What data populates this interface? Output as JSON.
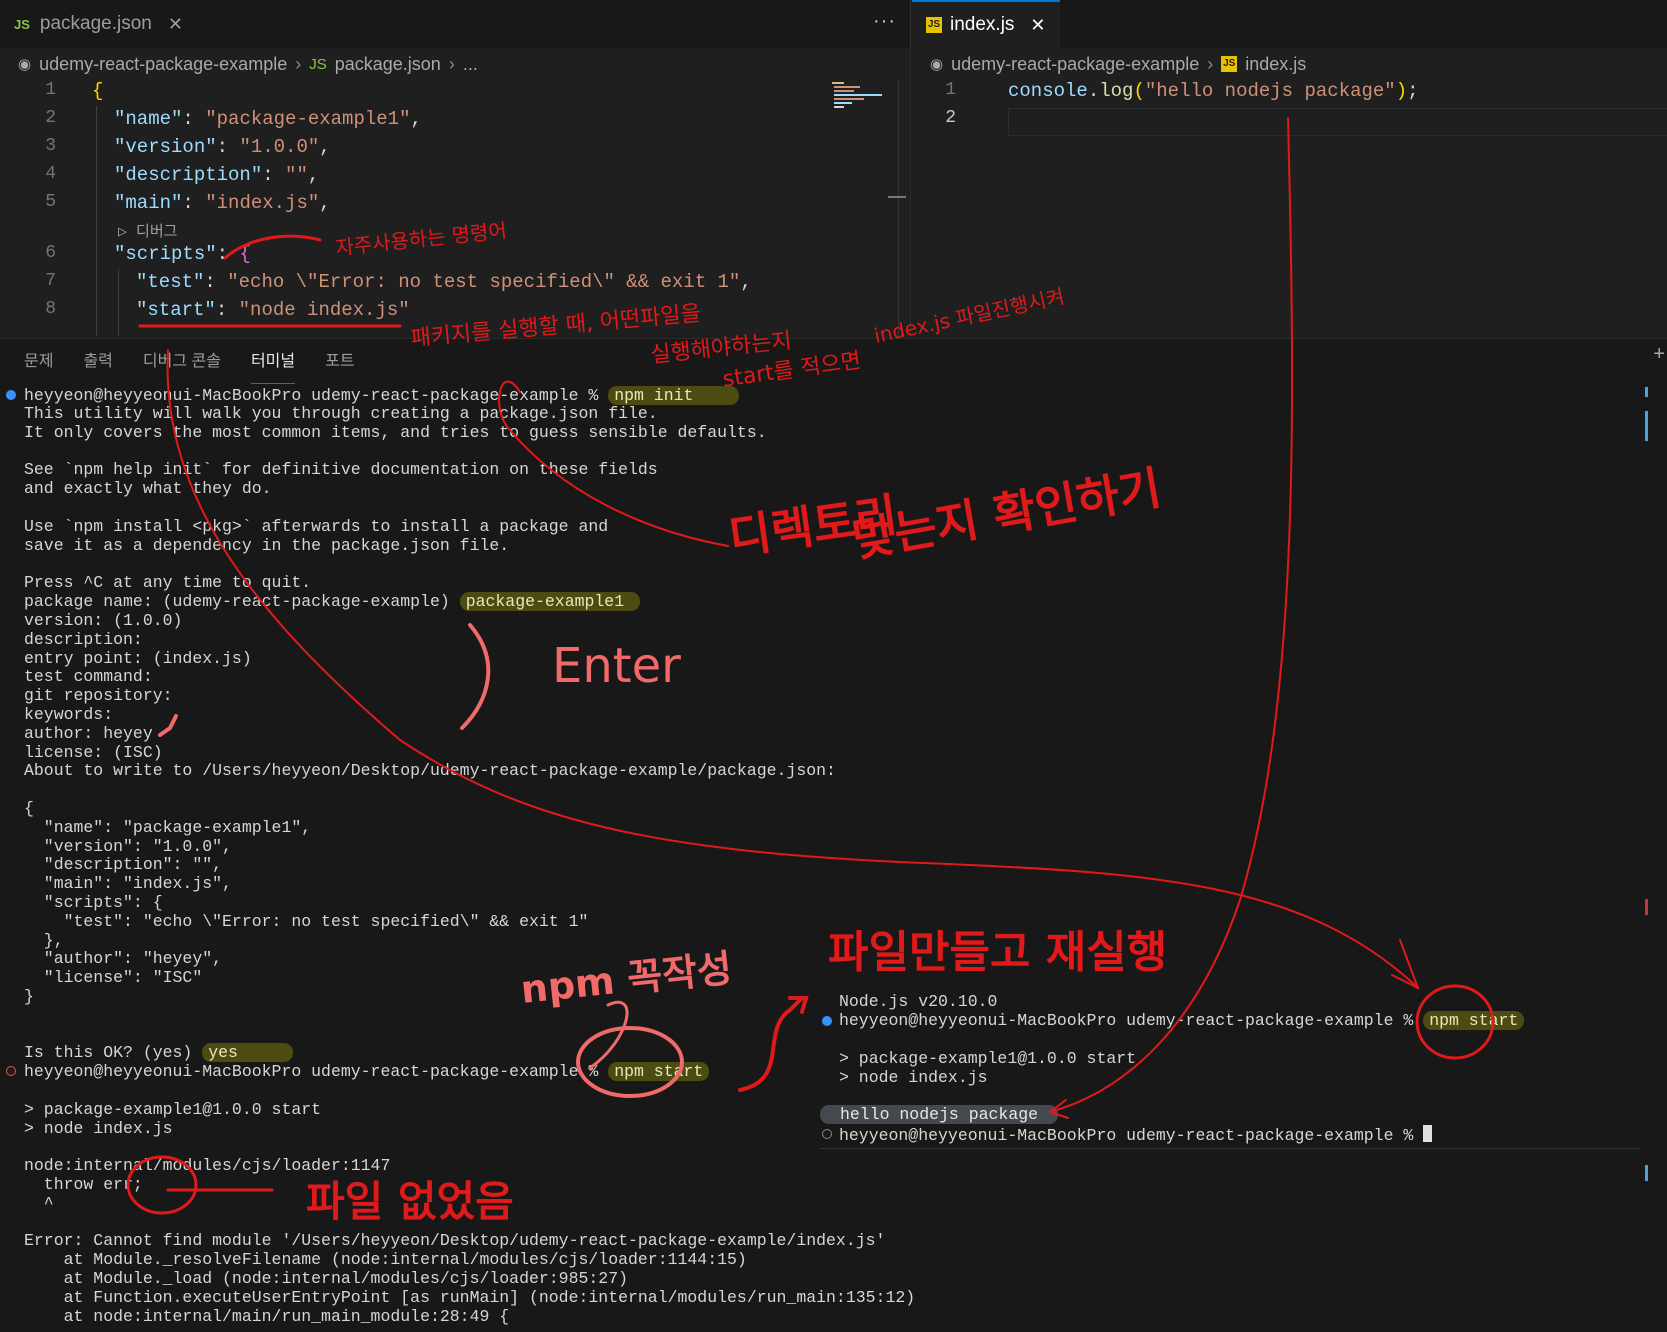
{
  "left_editor": {
    "tab_label": "package.json",
    "tab_icon": "JS",
    "more_label": "···",
    "breadcrumb": [
      "udemy-react-package-example",
      "package.json",
      "..."
    ],
    "line_numbers": [
      "1",
      "2",
      "3",
      "4",
      "5",
      "6",
      "7",
      "8"
    ],
    "codelens": "▷ 디버그",
    "code": {
      "l1": "{",
      "l2_key": "\"name\"",
      "l2_val": "\"package-example1\"",
      "l3_key": "\"version\"",
      "l3_val": "\"1.0.0\"",
      "l4_key": "\"description\"",
      "l4_val": "\"\"",
      "l5_key": "\"main\"",
      "l5_val": "\"index.js\"",
      "l6_key": "\"scripts\"",
      "l6_brace": "{",
      "l7_key": "\"test\"",
      "l7_val": "\"echo \\\"Error: no test specified\\\" && exit 1\"",
      "l8_key": "\"start\"",
      "l8_val": "\"node index.js\""
    }
  },
  "right_editor": {
    "tab_label": "index.js",
    "tab_icon": "JS",
    "breadcrumb": [
      "udemy-react-package-example",
      "index.js"
    ],
    "line_numbers": [
      "1",
      "2"
    ],
    "code": {
      "obj": "console",
      "fn": "log",
      "str": "\"hello nodejs package\""
    }
  },
  "panel": {
    "tabs": [
      "문제",
      "출력",
      "디버그 콘솔",
      "터미널",
      "포트"
    ],
    "active_tab": "터미널"
  },
  "terminal_left": {
    "prompt": "heyyeon@heyyeonui-MacBookPro udemy-react-package-example %",
    "cmd_init": "npm init",
    "intro": [
      "This utility will walk you through creating a package.json file.",
      "It only covers the most common items, and tries to guess sensible defaults.",
      "",
      "See `npm help init` for definitive documentation on these fields",
      "and exactly what they do.",
      "",
      "Use `npm install <pkg>` afterwards to install a package and",
      "save it as a dependency in the package.json file.",
      "",
      "Press ^C at any time to quit."
    ],
    "pkg_name_prompt": "package name: (udemy-react-package-example)",
    "pkg_name_answer": "package-example1",
    "questions": [
      "version: (1.0.0)",
      "description:",
      "entry point: (index.js)",
      "test command:",
      "git repository:",
      "keywords:",
      "author: heyey",
      "license: (ISC)",
      "About to write to /Users/heyyeon/Desktop/udemy-react-package-example/package.json:",
      "",
      "{",
      "  \"name\": \"package-example1\",",
      "  \"version\": \"1.0.0\",",
      "  \"description\": \"\",",
      "  \"main\": \"index.js\",",
      "  \"scripts\": {",
      "    \"test\": \"echo \\\"Error: no test specified\\\" && exit 1\"",
      "  },",
      "  \"author\": \"heyey\",",
      "  \"license\": \"ISC\"",
      "}"
    ],
    "ok_prompt": "Is this OK? (yes)",
    "ok_answer": "yes",
    "cmd_start": "npm start",
    "after": [
      "",
      "> package-example1@1.0.0 start",
      "> node index.js",
      "",
      "node:internal/modules/cjs/loader:1147",
      "  throw err;",
      "  ^",
      "",
      "Error: Cannot find module '/Users/heyyeon/Desktop/udemy-react-package-example/index.js'",
      "    at Module._resolveFilename (node:internal/modules/cjs/loader:1144:15)",
      "    at Module._load (node:internal/modules/cjs/loader:985:27)",
      "    at Function.executeUserEntryPoint [as runMain] (node:internal/modules/run_main:135:12)",
      "    at node:internal/main/run_main_module:28:49 {"
    ]
  },
  "terminal_right": {
    "node_version": "Node.js v20.10.0",
    "prompt": "heyyeon@heyyeonui-MacBookPro udemy-react-package-example %",
    "cmd": "npm start",
    "lines": [
      "",
      "> package-example1@1.0.0 start",
      "> node index.js",
      ""
    ],
    "output": "hello nodejs package"
  },
  "annotations": {
    "frequent_cmd": "자주사용하는 명령어",
    "start_desc_1": "패키지를 실행할 때, 어떤파일을",
    "start_desc_2": "실행해야하는지",
    "start_desc_3": "start를 적으면",
    "start_desc_4": "index.js 파일진행시켜",
    "check": "디렉토리",
    "check_2": "맞는지 확인하기",
    "enter": "Enter",
    "npm_must": "npm 꼭작성",
    "no_file": "파일 없었음",
    "remake": "파일만들고 재실행"
  },
  "colors": {
    "accent": "#0078d4",
    "annotation_red": "#e01a1a",
    "annotation_pink": "#f06a6a",
    "highlight": "#4b4b12"
  }
}
